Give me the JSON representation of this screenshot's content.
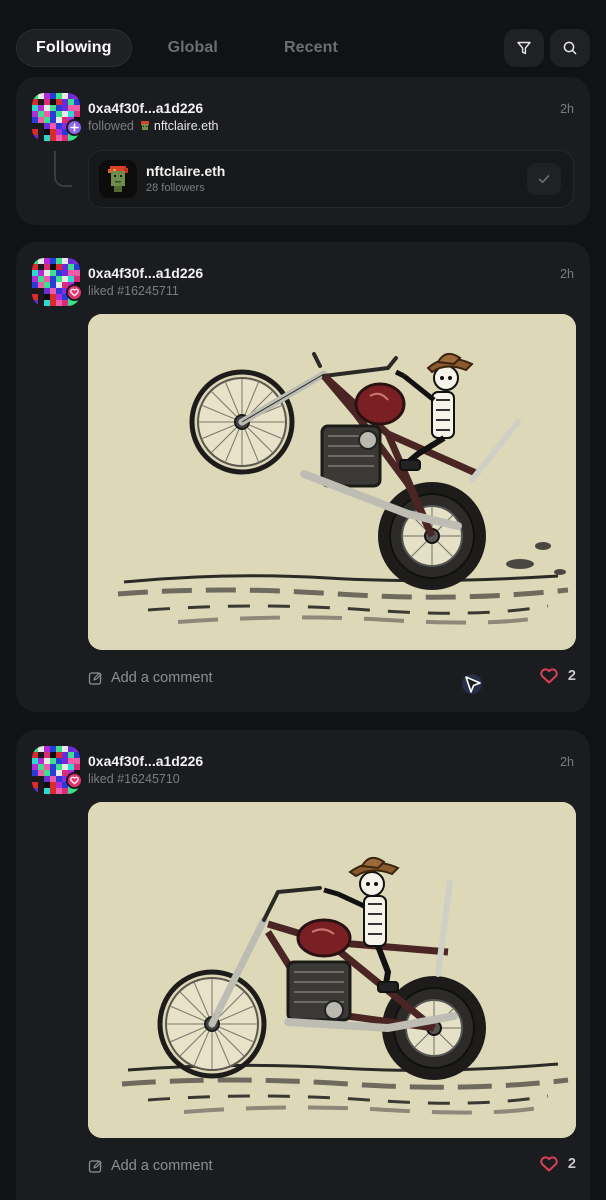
{
  "tabs": [
    {
      "label": "Following",
      "active": true
    },
    {
      "label": "Global",
      "active": false
    },
    {
      "label": "Recent",
      "active": false
    }
  ],
  "header_icons": [
    "filter-icon",
    "search-icon"
  ],
  "feed": {
    "follow_post": {
      "user": "0xa4f30f...a1d226",
      "action": "followed",
      "target": "nftclaire.eth",
      "time": "2h",
      "followed_user": {
        "name": "nftclaire.eth",
        "followers": "28 followers"
      }
    },
    "like_posts": [
      {
        "user": "0xa4f30f...a1d226",
        "action": "liked #16245711",
        "time": "2h",
        "comment_placeholder": "Add a comment",
        "likes": "2"
      },
      {
        "user": "0xa4f30f...a1d226",
        "action": "liked #16245710",
        "time": "2h",
        "comment_placeholder": "Add a comment",
        "likes": "2"
      }
    ]
  },
  "colors": {
    "background": "#111214",
    "card": "#1b1c1f",
    "follow_badge": "#8f63e8",
    "like_badge": "#e6336f",
    "image_background": "#ddd9b8",
    "heart": "#d9405a"
  }
}
